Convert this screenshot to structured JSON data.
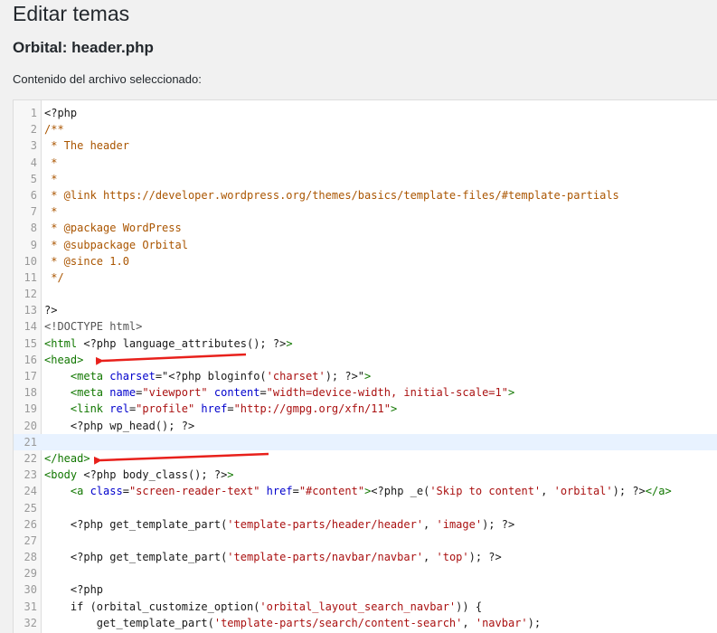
{
  "page": {
    "title": "Editar temas",
    "file_title": "Orbital: header.php",
    "content_label": "Contenido del archivo seleccionado:"
  },
  "editor": {
    "active_line": 21,
    "annotation_arrow_color": "#e8201b",
    "lines": [
      {
        "n": "1",
        "tokens": [
          {
            "t": "<?php",
            "c": "plain"
          }
        ]
      },
      {
        "n": "2",
        "tokens": [
          {
            "t": "/**",
            "c": "comment"
          }
        ]
      },
      {
        "n": "3",
        "tokens": [
          {
            "t": " * The header",
            "c": "comment"
          }
        ]
      },
      {
        "n": "4",
        "tokens": [
          {
            "t": " *",
            "c": "comment"
          }
        ]
      },
      {
        "n": "5",
        "tokens": [
          {
            "t": " *",
            "c": "comment"
          }
        ]
      },
      {
        "n": "6",
        "tokens": [
          {
            "t": " * @link https://developer.wordpress.org/themes/basics/template-files/#template-partials",
            "c": "comment"
          }
        ]
      },
      {
        "n": "7",
        "tokens": [
          {
            "t": " *",
            "c": "comment"
          }
        ]
      },
      {
        "n": "8",
        "tokens": [
          {
            "t": " * @package WordPress",
            "c": "comment"
          }
        ]
      },
      {
        "n": "9",
        "tokens": [
          {
            "t": " * @subpackage Orbital",
            "c": "comment"
          }
        ]
      },
      {
        "n": "10",
        "tokens": [
          {
            "t": " * @since 1.0",
            "c": "comment"
          }
        ]
      },
      {
        "n": "11",
        "tokens": [
          {
            "t": " */",
            "c": "comment"
          }
        ]
      },
      {
        "n": "12",
        "tokens": []
      },
      {
        "n": "13",
        "tokens": [
          {
            "t": "?>",
            "c": "plain"
          }
        ]
      },
      {
        "n": "14",
        "tokens": [
          {
            "t": "<!DOCTYPE html>",
            "c": "meta"
          }
        ]
      },
      {
        "n": "15",
        "tokens": [
          {
            "t": "<html",
            "c": "tag"
          },
          {
            "t": " <?php language_attributes(); ?>",
            "c": "plain"
          },
          {
            "t": ">",
            "c": "tag"
          }
        ]
      },
      {
        "n": "16",
        "tokens": [
          {
            "t": "<head>",
            "c": "tag"
          }
        ]
      },
      {
        "n": "17",
        "tokens": [
          {
            "t": "    ",
            "c": "plain"
          },
          {
            "t": "<meta",
            "c": "tag"
          },
          {
            "t": " charset",
            "c": "attr"
          },
          {
            "t": "=\"<?php bloginfo(",
            "c": "plain"
          },
          {
            "t": "'charset'",
            "c": "string"
          },
          {
            "t": "); ?>\"",
            "c": "plain"
          },
          {
            "t": ">",
            "c": "tag"
          }
        ]
      },
      {
        "n": "18",
        "tokens": [
          {
            "t": "    ",
            "c": "plain"
          },
          {
            "t": "<meta",
            "c": "tag"
          },
          {
            "t": " name",
            "c": "attr"
          },
          {
            "t": "=",
            "c": "plain"
          },
          {
            "t": "\"viewport\"",
            "c": "string"
          },
          {
            "t": " content",
            "c": "attr"
          },
          {
            "t": "=",
            "c": "plain"
          },
          {
            "t": "\"width=device-width, initial-scale=1\"",
            "c": "string"
          },
          {
            "t": ">",
            "c": "tag"
          }
        ]
      },
      {
        "n": "19",
        "tokens": [
          {
            "t": "    ",
            "c": "plain"
          },
          {
            "t": "<link",
            "c": "tag"
          },
          {
            "t": " rel",
            "c": "attr"
          },
          {
            "t": "=",
            "c": "plain"
          },
          {
            "t": "\"profile\"",
            "c": "string"
          },
          {
            "t": " href",
            "c": "attr"
          },
          {
            "t": "=",
            "c": "plain"
          },
          {
            "t": "\"http://gmpg.org/xfn/11\"",
            "c": "string"
          },
          {
            "t": ">",
            "c": "tag"
          }
        ]
      },
      {
        "n": "20",
        "tokens": [
          {
            "t": "    <?php wp_head(); ?>",
            "c": "plain"
          }
        ]
      },
      {
        "n": "21",
        "tokens": []
      },
      {
        "n": "22",
        "tokens": [
          {
            "t": "</head>",
            "c": "tag"
          }
        ]
      },
      {
        "n": "23",
        "tokens": [
          {
            "t": "<body",
            "c": "tag"
          },
          {
            "t": " <?php body_class(); ?>",
            "c": "plain"
          },
          {
            "t": ">",
            "c": "tag"
          }
        ]
      },
      {
        "n": "24",
        "tokens": [
          {
            "t": "    ",
            "c": "plain"
          },
          {
            "t": "<a",
            "c": "tag"
          },
          {
            "t": " class",
            "c": "attr"
          },
          {
            "t": "=",
            "c": "plain"
          },
          {
            "t": "\"screen-reader-text\"",
            "c": "string"
          },
          {
            "t": " href",
            "c": "attr"
          },
          {
            "t": "=",
            "c": "plain"
          },
          {
            "t": "\"#content\"",
            "c": "string"
          },
          {
            "t": ">",
            "c": "tag"
          },
          {
            "t": "<?php _e(",
            "c": "plain"
          },
          {
            "t": "'Skip to content'",
            "c": "string"
          },
          {
            "t": ", ",
            "c": "plain"
          },
          {
            "t": "'orbital'",
            "c": "string"
          },
          {
            "t": "); ?>",
            "c": "plain"
          },
          {
            "t": "</a>",
            "c": "tag"
          }
        ]
      },
      {
        "n": "25",
        "tokens": []
      },
      {
        "n": "26",
        "tokens": [
          {
            "t": "    <?php get_template_part(",
            "c": "plain"
          },
          {
            "t": "'template-parts/header/header'",
            "c": "string"
          },
          {
            "t": ", ",
            "c": "plain"
          },
          {
            "t": "'image'",
            "c": "string"
          },
          {
            "t": "); ?>",
            "c": "plain"
          }
        ]
      },
      {
        "n": "27",
        "tokens": []
      },
      {
        "n": "28",
        "tokens": [
          {
            "t": "    <?php get_template_part(",
            "c": "plain"
          },
          {
            "t": "'template-parts/navbar/navbar'",
            "c": "string"
          },
          {
            "t": ", ",
            "c": "plain"
          },
          {
            "t": "'top'",
            "c": "string"
          },
          {
            "t": "); ?>",
            "c": "plain"
          }
        ]
      },
      {
        "n": "29",
        "tokens": []
      },
      {
        "n": "30",
        "tokens": [
          {
            "t": "    <?php",
            "c": "plain"
          }
        ]
      },
      {
        "n": "31",
        "tokens": [
          {
            "t": "    if (orbital_customize_option(",
            "c": "plain"
          },
          {
            "t": "'orbital_layout_search_navbar'",
            "c": "string"
          },
          {
            "t": ")) {",
            "c": "plain"
          }
        ]
      },
      {
        "n": "32",
        "tokens": [
          {
            "t": "        get_template_part(",
            "c": "plain"
          },
          {
            "t": "'template-parts/search/content-search'",
            "c": "string"
          },
          {
            "t": ", ",
            "c": "plain"
          },
          {
            "t": "'navbar'",
            "c": "string"
          },
          {
            "t": ");",
            "c": "plain"
          }
        ]
      }
    ]
  }
}
